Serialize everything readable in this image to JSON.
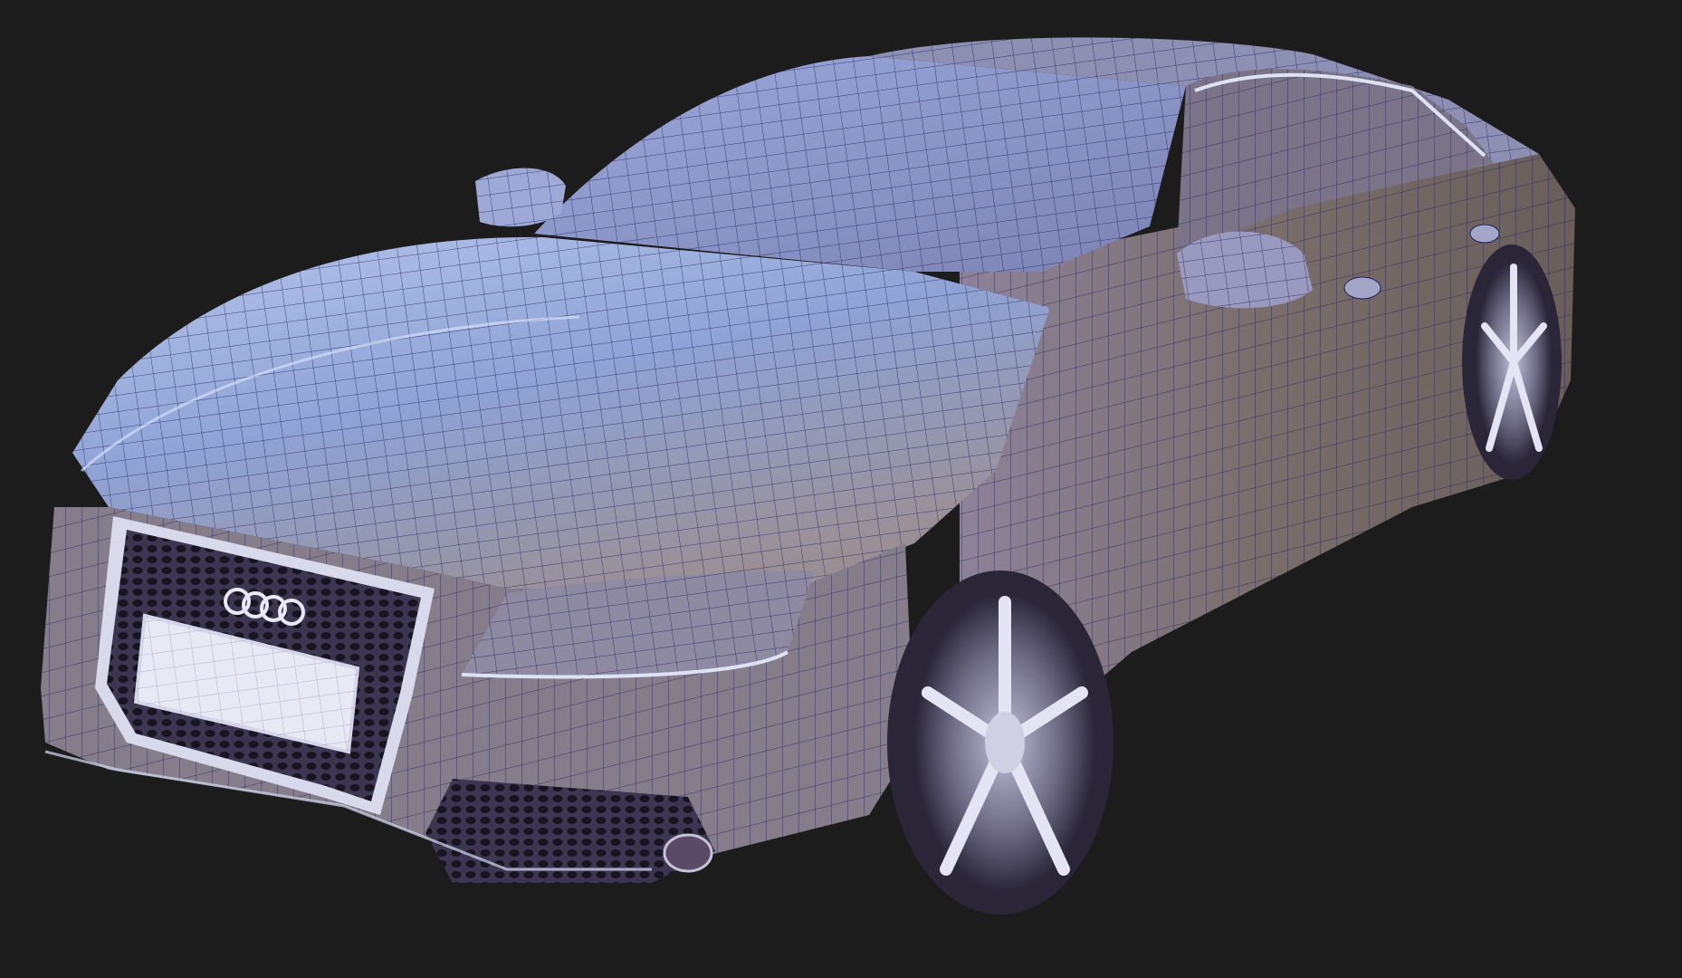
{
  "viewport": {
    "background": "#1c1c1c",
    "subject": "car-wireframe-model",
    "colors": {
      "body_light": "#b9c8e8",
      "body_mid": "#8f8fb0",
      "body_dark": "#6e5f55",
      "glass": "#8d92b8",
      "wire": "#1d1f5a",
      "chrome": "#d8d8ee",
      "grille": "#3a3348"
    },
    "badge": {
      "type": "four-ring-logo"
    },
    "plate": {
      "text": ""
    }
  }
}
